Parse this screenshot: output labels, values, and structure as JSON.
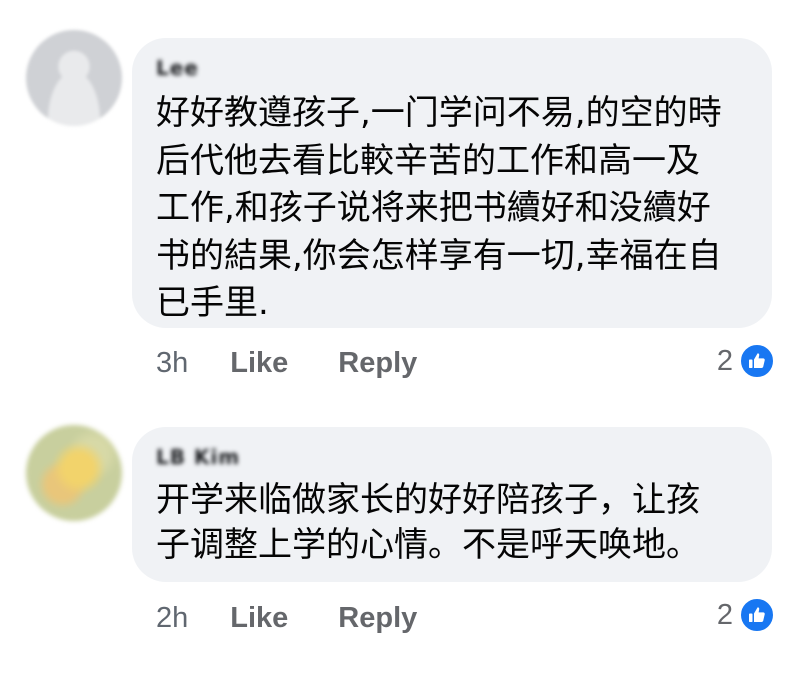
{
  "comments": [
    {
      "author": "Lee",
      "text": "好好教遵孩子,一门学问不易,的空的時\n后代他去看比較辛苦的工作和高一及\n工作,和孩子说将来把书續好和没續好\n书的結果,你会怎样享有一切,幸福在自\n已手里.",
      "time": "3h",
      "like_label": "Like",
      "reply_label": "Reply",
      "reaction_count": "2"
    },
    {
      "author": "LB Kim",
      "text": "开学来临做家长的好好陪孩子，让孩\n子调整上学的心情。不是呼天唤地。",
      "time": "2h",
      "like_label": "Like",
      "reply_label": "Reply",
      "reaction_count": "2"
    }
  ],
  "colors": {
    "bubble": "#f0f2f5",
    "like_blue": "#1877f2",
    "meta_gray": "#65676b"
  },
  "icons": {
    "reaction": "thumbs-up-icon",
    "avatar": "avatar"
  }
}
